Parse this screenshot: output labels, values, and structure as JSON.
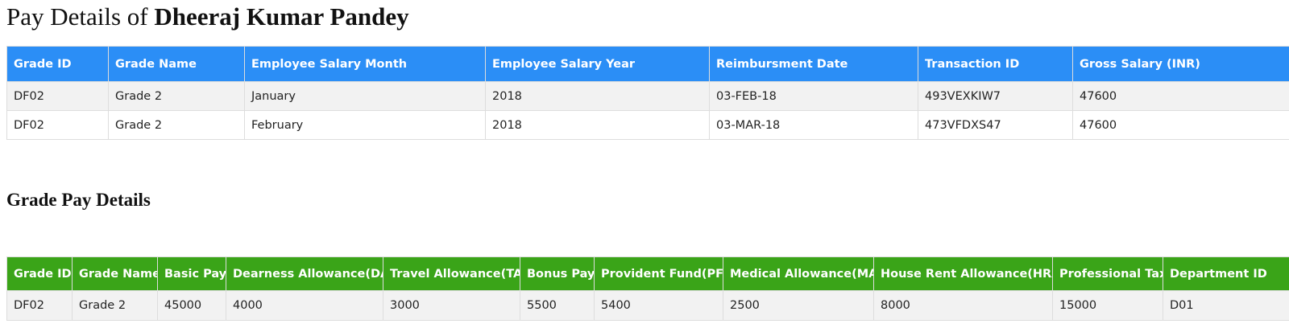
{
  "header": {
    "title_prefix": "Pay Details of",
    "employee_name": "Dheeraj Kumar Pandey"
  },
  "pay_table": {
    "columns": [
      "Grade ID",
      "Grade Name",
      "Employee Salary Month",
      "Employee Salary Year",
      "Reimbursment Date",
      "Transaction ID",
      "Gross Salary (INR)"
    ],
    "rows": [
      [
        "DF02",
        "Grade 2",
        "January",
        "2018",
        "03-FEB-18",
        "493VEXKIW7",
        "47600"
      ],
      [
        "DF02",
        "Grade 2",
        "February",
        "2018",
        "03-MAR-18",
        "473VFDXS47",
        "47600"
      ]
    ]
  },
  "grade_section": {
    "title": "Grade Pay Details"
  },
  "grade_table": {
    "columns": [
      "Grade ID",
      "Grade Name",
      "Basic Pay",
      "Dearness Allowance(DA)",
      "Travel Allowance(TA)",
      "Bonus Pay",
      "Provident Fund(PF)",
      "Medical Allowance(MA)",
      "House Rent Allowance(HRA)",
      "Professional Tax",
      "Department ID"
    ],
    "rows": [
      [
        "DF02",
        "Grade 2",
        "45000",
        "4000",
        "3000",
        "5500",
        "5400",
        "2500",
        "8000",
        "15000",
        "D01"
      ]
    ]
  },
  "colors": {
    "pay_header_bg": "#2b8ef6",
    "grade_header_bg": "#3aa418",
    "odd_row_bg": "#f2f2f2",
    "border": "#dddddd"
  }
}
